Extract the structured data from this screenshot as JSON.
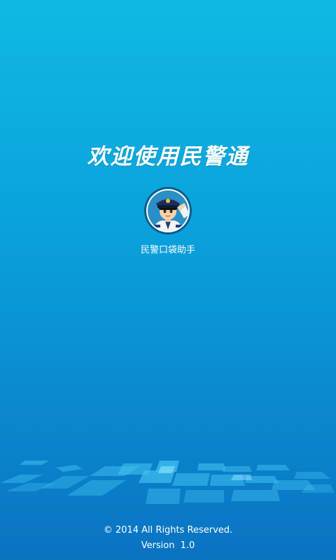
{
  "splash": {
    "title": "欢迎使用民警通",
    "logo_icon": "police-officer-icon",
    "logo_caption": "民警口袋助手"
  },
  "footer": {
    "copyright": "© 2014  All Rights Reserved.",
    "version": "Version  1.0"
  },
  "colors": {
    "background_top": "#0fb9e3",
    "background_bottom": "#0a73c2",
    "text": "#ffffff"
  }
}
